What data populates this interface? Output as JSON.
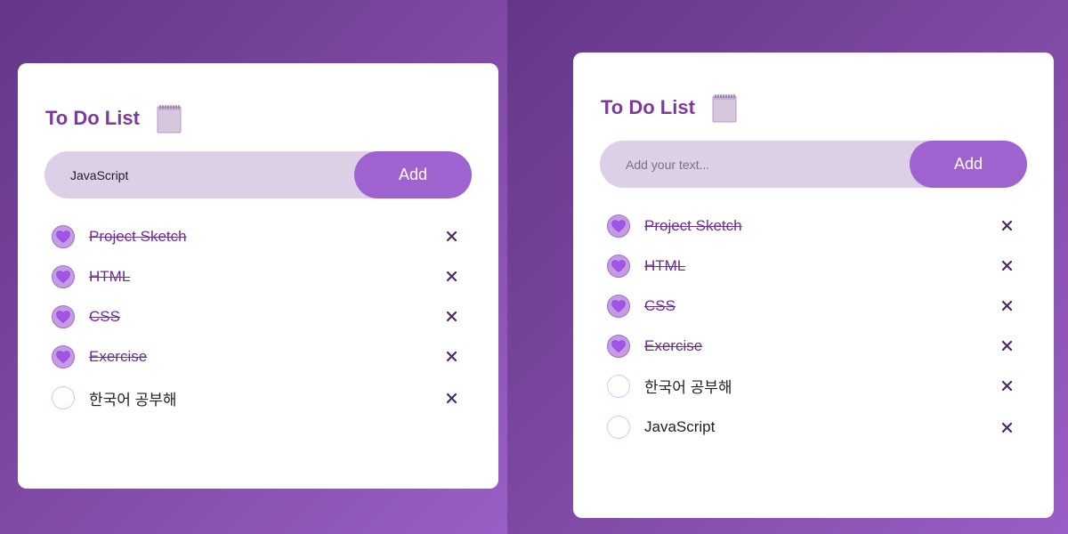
{
  "left": {
    "title": "To Do List",
    "input_value": "JavaScript",
    "input_placeholder": "Add your text...",
    "add_label": "Add",
    "items": [
      {
        "text": "Project Sketch",
        "done": true
      },
      {
        "text": "HTML",
        "done": true
      },
      {
        "text": "CSS",
        "done": true
      },
      {
        "text": "Exercise",
        "done": true
      },
      {
        "text": "한국어 공부해",
        "done": false
      }
    ]
  },
  "right": {
    "title": "To Do List",
    "input_value": "",
    "input_placeholder": "Add your text...",
    "add_label": "Add",
    "items": [
      {
        "text": "Project Sketch",
        "done": true
      },
      {
        "text": "HTML",
        "done": true
      },
      {
        "text": "CSS",
        "done": true
      },
      {
        "text": "Exercise",
        "done": true
      },
      {
        "text": "한국어 공부해",
        "done": false
      },
      {
        "text": "JavaScript",
        "done": false
      }
    ]
  },
  "icons": {
    "title_icon": "notepad-icon",
    "done_icon": "heart-icon",
    "delete_icon": "close-icon"
  },
  "colors": {
    "accent": "#9f63cf",
    "title": "#7c3a9a",
    "input_bg": "#ddcfe6",
    "done_text": "#6b2f8f"
  }
}
